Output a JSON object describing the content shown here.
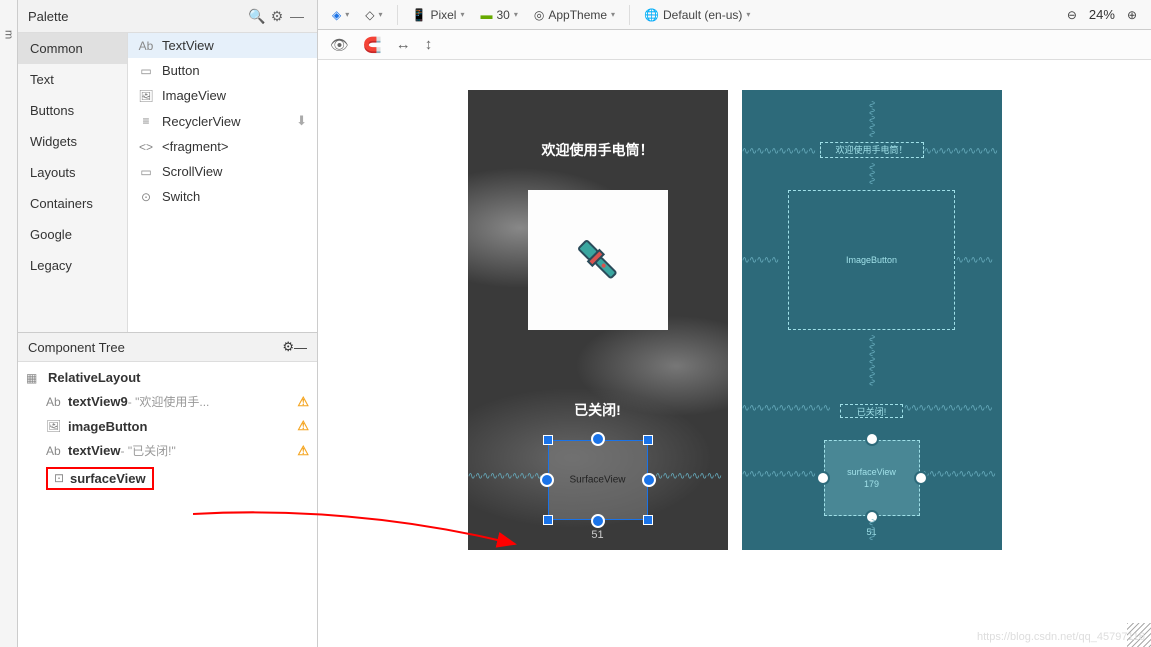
{
  "palette": {
    "title": "Palette",
    "categories": [
      "Common",
      "Text",
      "Buttons",
      "Widgets",
      "Layouts",
      "Containers",
      "Google",
      "Legacy"
    ],
    "selected_category": "Common",
    "items": [
      {
        "icon": "Ab",
        "label": "TextView",
        "selected": true
      },
      {
        "icon": "■",
        "label": "Button"
      },
      {
        "icon": "⬚",
        "label": "ImageView"
      },
      {
        "icon": "≡",
        "label": "RecyclerView",
        "download": true
      },
      {
        "icon": "<>",
        "label": "<fragment>"
      },
      {
        "icon": "▭",
        "label": "ScrollView"
      },
      {
        "icon": "⊙",
        "label": "Switch"
      }
    ]
  },
  "component_tree": {
    "title": "Component Tree",
    "root": "RelativeLayout",
    "children": [
      {
        "icon": "Ab",
        "id": "textView9",
        "sub": "\"欢迎使用手...",
        "warn": true
      },
      {
        "icon": "⬚",
        "id": "imageButton",
        "warn": true
      },
      {
        "icon": "Ab",
        "id": "textView",
        "sub": "\"已关闭!\"",
        "warn": true
      },
      {
        "icon": "⊡",
        "id": "surfaceView",
        "highlight": true
      }
    ]
  },
  "toolbar": {
    "device": "Pixel",
    "api": "30",
    "theme": "AppTheme",
    "locale": "Default (en-us)",
    "zoom": "24%"
  },
  "design": {
    "welcome": "欢迎使用手电筒！",
    "status": "已关闭!",
    "surface_label": "SurfaceView",
    "dim_below": "51"
  },
  "blueprint": {
    "welcome": "欢迎使用手电筒！",
    "img_label": "ImageButton",
    "status": "已关闭!",
    "surface_label": "surfaceView",
    "dim_inside": "179",
    "dim_below": "51"
  },
  "watermark": "https://blog.csdn.net/qq_45797116"
}
